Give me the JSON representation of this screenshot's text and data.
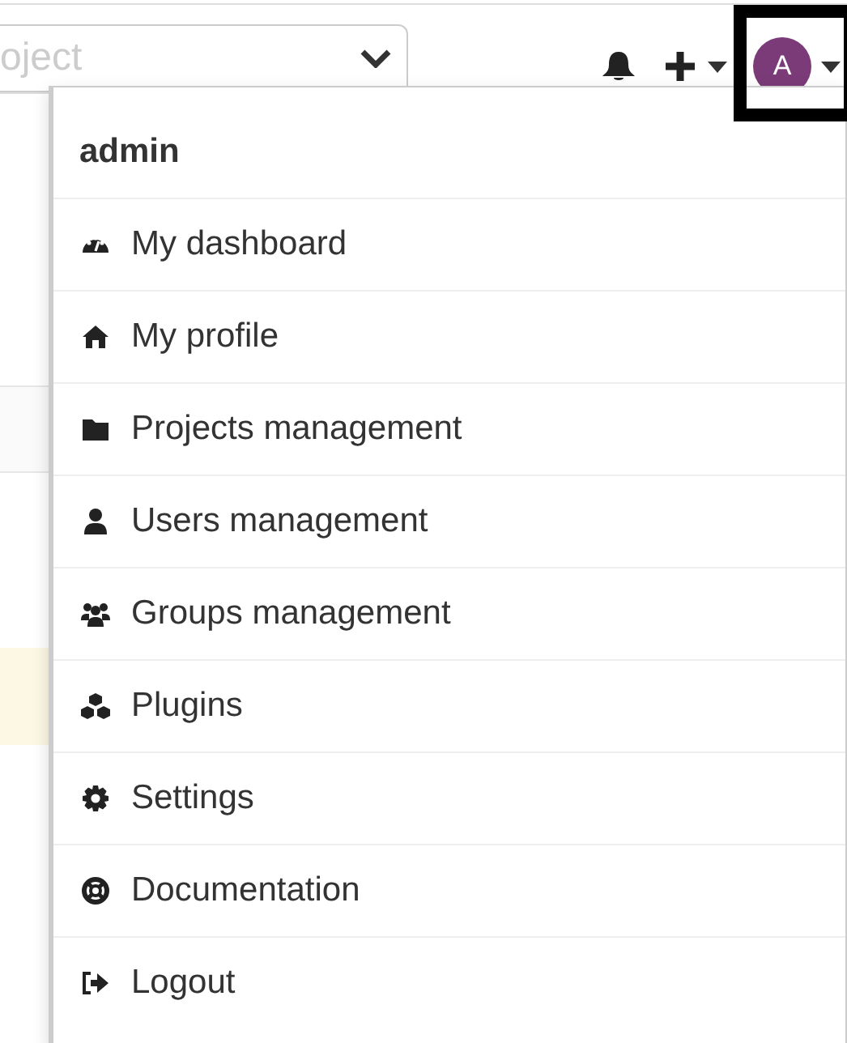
{
  "search": {
    "placeholder": "oject"
  },
  "navbar": {
    "avatar_initial": "A",
    "avatar_highlighted": true
  },
  "user_menu": {
    "header": "admin",
    "items": [
      {
        "label": "My dashboard"
      },
      {
        "label": "My profile"
      },
      {
        "label": "Projects management"
      },
      {
        "label": "Users management"
      },
      {
        "label": "Groups management"
      },
      {
        "label": "Plugins"
      },
      {
        "label": "Settings"
      },
      {
        "label": "Documentation"
      },
      {
        "label": "Logout"
      }
    ]
  }
}
